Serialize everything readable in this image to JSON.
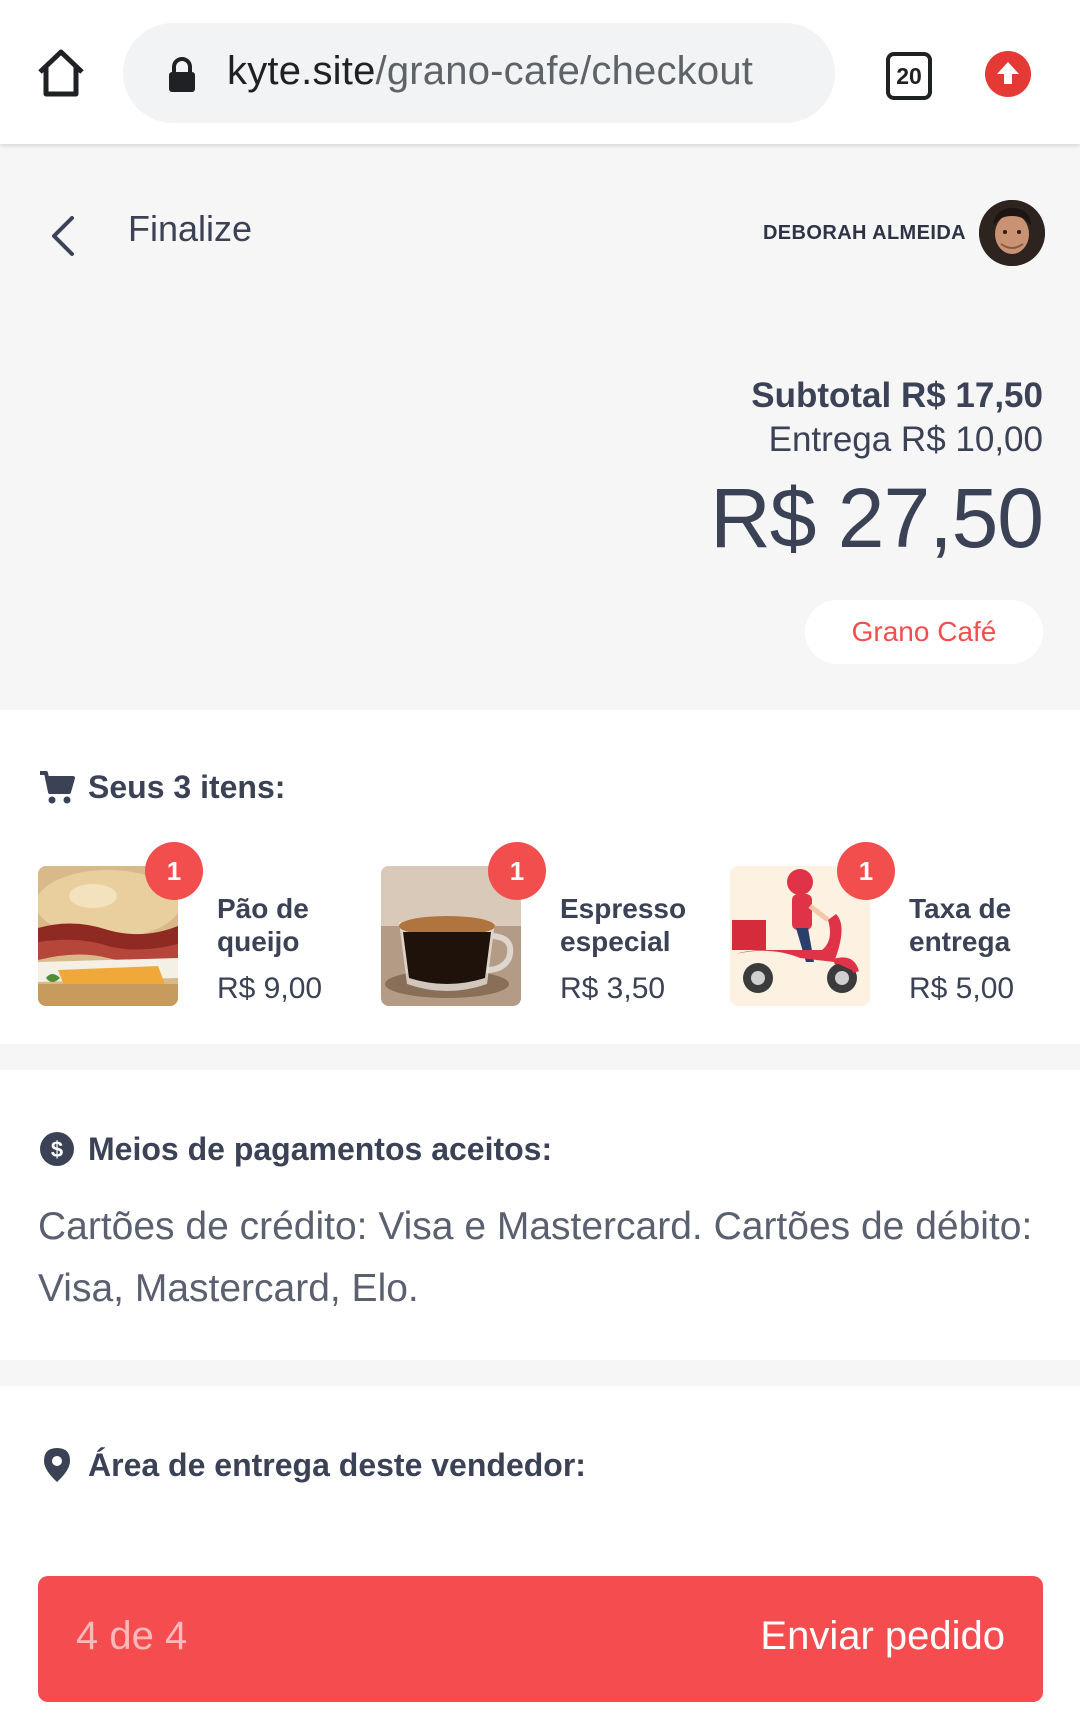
{
  "browser": {
    "url_domain": "kyte.site",
    "url_path": "/grano-cafe/checkout",
    "tab_count": "20"
  },
  "header": {
    "title": "Finalize",
    "user_name": "DEBORAH ALMEIDA"
  },
  "summary": {
    "subtotal": "Subtotal R$ 17,50",
    "delivery": "Entrega R$ 10,00",
    "total": "R$ 27,50",
    "store_name": "Grano Café"
  },
  "items": {
    "heading": "Seus 3 itens:",
    "list": [
      {
        "qty": "1",
        "name": "Pão de queijo",
        "price": "R$ 9,00"
      },
      {
        "qty": "1",
        "name": "Espresso especial",
        "price": "R$ 3,50"
      },
      {
        "qty": "1",
        "name": "Taxa de entrega",
        "price": "R$ 5,00"
      }
    ]
  },
  "payments": {
    "heading": "Meios de pagamentos aceitos:",
    "text": "Cartões de crédito: Visa e Mastercard. Cartões de débito: Visa, Mastercard, Elo."
  },
  "delivery_area": {
    "heading": "Área de entrega deste vendedor:"
  },
  "footer": {
    "step": "4 de 4",
    "submit_label": "Enviar pedido"
  },
  "colors": {
    "accent": "#f54d4f",
    "text": "#3b4256",
    "background": "#f6f6f7"
  }
}
